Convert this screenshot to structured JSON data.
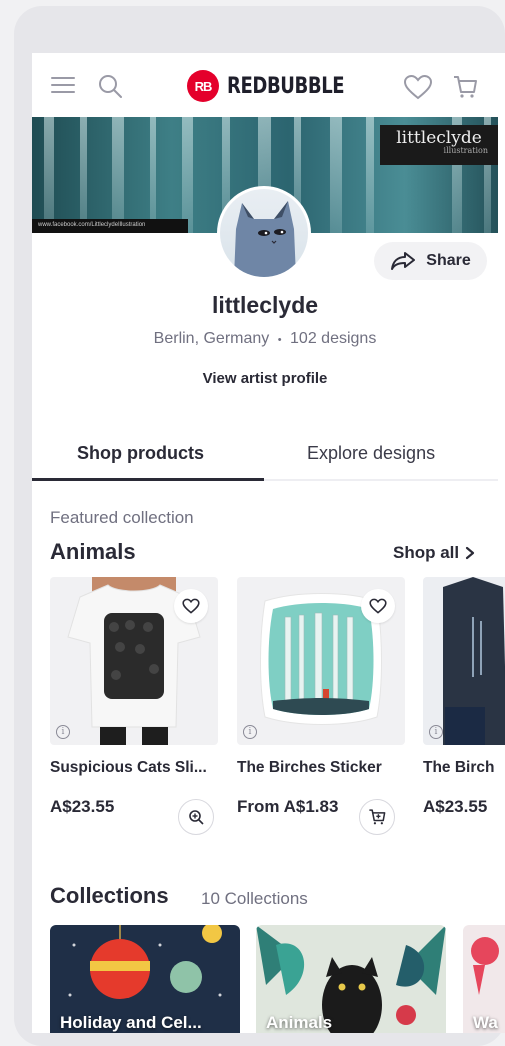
{
  "header": {
    "logo_badge": "RB",
    "logo_text": "REDBUBBLE",
    "brand_color": "#e4002b"
  },
  "banner": {
    "tag_title": "littleclyde",
    "tag_sub": "illustration",
    "url_text": "www.facebook.com/LittleclydeIllustration"
  },
  "profile": {
    "name": "littleclyde",
    "location": "Berlin, Germany",
    "separator": "•",
    "designs": "102 designs",
    "share_label": "Share",
    "view_profile": "View artist profile"
  },
  "tabs": [
    {
      "label": "Shop products",
      "active": true
    },
    {
      "label": "Explore designs",
      "active": false
    }
  ],
  "featured": {
    "label": "Featured collection",
    "title": "Animals",
    "shop_all": "Shop all"
  },
  "products": [
    {
      "title": "Suspicious Cats Sli...",
      "price": "A$23.55",
      "action_icon": "zoom-in-icon"
    },
    {
      "title": "The Birches Sticker",
      "price": "From A$1.83",
      "action_icon": "add-to-cart-icon"
    },
    {
      "title": "The Birch",
      "price": "A$23.55"
    }
  ],
  "collections": {
    "title": "Collections",
    "count": "10 Collections",
    "items": [
      {
        "label": "Holiday and Cel..."
      },
      {
        "label": "Animals"
      },
      {
        "label": "Wa"
      }
    ]
  }
}
